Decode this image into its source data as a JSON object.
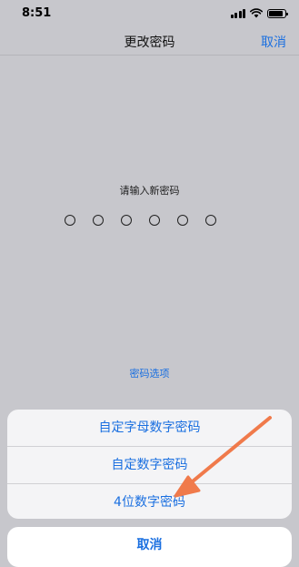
{
  "status_bar": {
    "time": "8:51"
  },
  "nav": {
    "title": "更改密码",
    "cancel": "取消"
  },
  "passcode": {
    "prompt": "请输入新密码",
    "digit_count": 6,
    "options_link": "密码选项"
  },
  "action_sheet": {
    "items": [
      "自定字母数字密码",
      "自定数字密码",
      "4位数字密码"
    ],
    "cancel": "取消"
  },
  "colors": {
    "accent": "#1a6fe0",
    "annotation_arrow": "#f07a4b"
  }
}
